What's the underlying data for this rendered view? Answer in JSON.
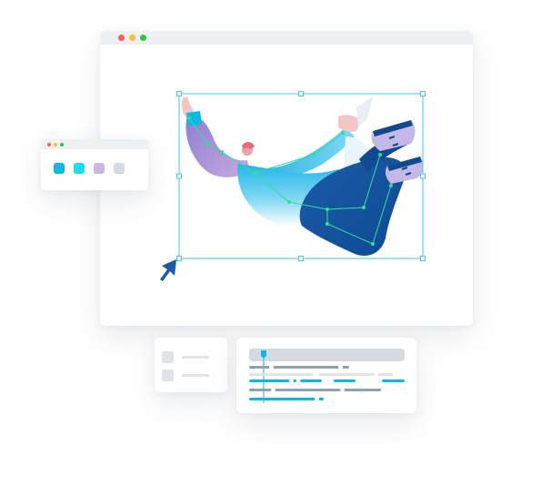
{
  "colors": {
    "selection": "#48c7e8",
    "handle_fill": "#ffffff",
    "skeleton": "#2ee09a",
    "cursor": "#1b5aa8",
    "window_dot_red": "#ff5b5b",
    "window_dot_yellow": "#ffbd2e",
    "window_dot_green": "#28c940",
    "track_blue": "#0cb8e6",
    "track_gray": "#8fa0b3",
    "track_light": "#dfe3ea"
  },
  "palette": {
    "swatches": [
      {
        "name": "swatch-blue",
        "color": "#0cb8e6"
      },
      {
        "name": "swatch-cyan",
        "color": "#18e0ef"
      },
      {
        "name": "swatch-lavender",
        "color": "#c9b6e3"
      },
      {
        "name": "swatch-gray",
        "color": "#d5dae1"
      }
    ]
  },
  "icons": {
    "cursor": "arrow-cursor-icon"
  },
  "timeline": {
    "playhead_color": "#0cb8e6"
  }
}
